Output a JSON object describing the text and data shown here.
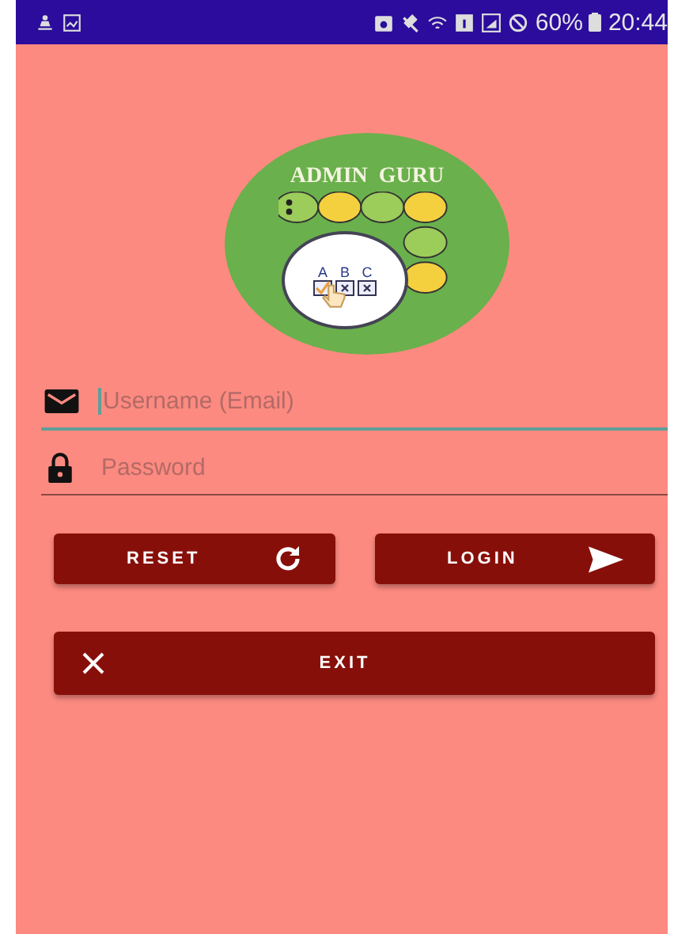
{
  "status_bar": {
    "battery": "60%",
    "time": "20:44"
  },
  "logo": {
    "title": "ADMIN  GURU",
    "options": [
      "A",
      "B",
      "C"
    ]
  },
  "fields": [
    {
      "kind": "email",
      "placeholder": "Username (Email)",
      "focused": true
    },
    {
      "kind": "password",
      "placeholder": "Password",
      "focused": false
    }
  ],
  "buttons": [
    {
      "kind": "reset",
      "label": "RESET"
    },
    {
      "kind": "login",
      "label": "LOGIN"
    }
  ],
  "exit_button": {
    "label": "EXIT"
  }
}
